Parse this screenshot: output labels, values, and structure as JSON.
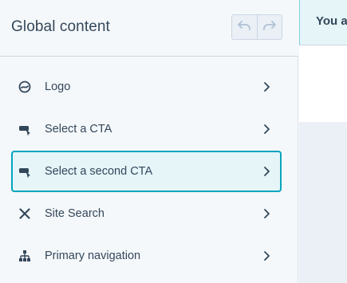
{
  "panel": {
    "title": "Global content",
    "undo_icon": "undo-icon",
    "redo_icon": "redo-icon"
  },
  "items": [
    {
      "label": "Logo",
      "icon": "logo-icon",
      "selected": false
    },
    {
      "label": "Select a CTA",
      "icon": "cta-icon",
      "selected": false
    },
    {
      "label": "Select a second CTA",
      "icon": "cta-icon",
      "selected": true
    },
    {
      "label": "Site Search",
      "icon": "site-search-icon",
      "selected": false
    },
    {
      "label": "Primary navigation",
      "icon": "sitemap-icon",
      "selected": false
    }
  ],
  "banner": {
    "text": "You a"
  },
  "colors": {
    "accent": "#00a4bd",
    "selected_bg": "#e5f5f8",
    "text": "#33475b",
    "panel_bg": "#f5f8fa"
  }
}
